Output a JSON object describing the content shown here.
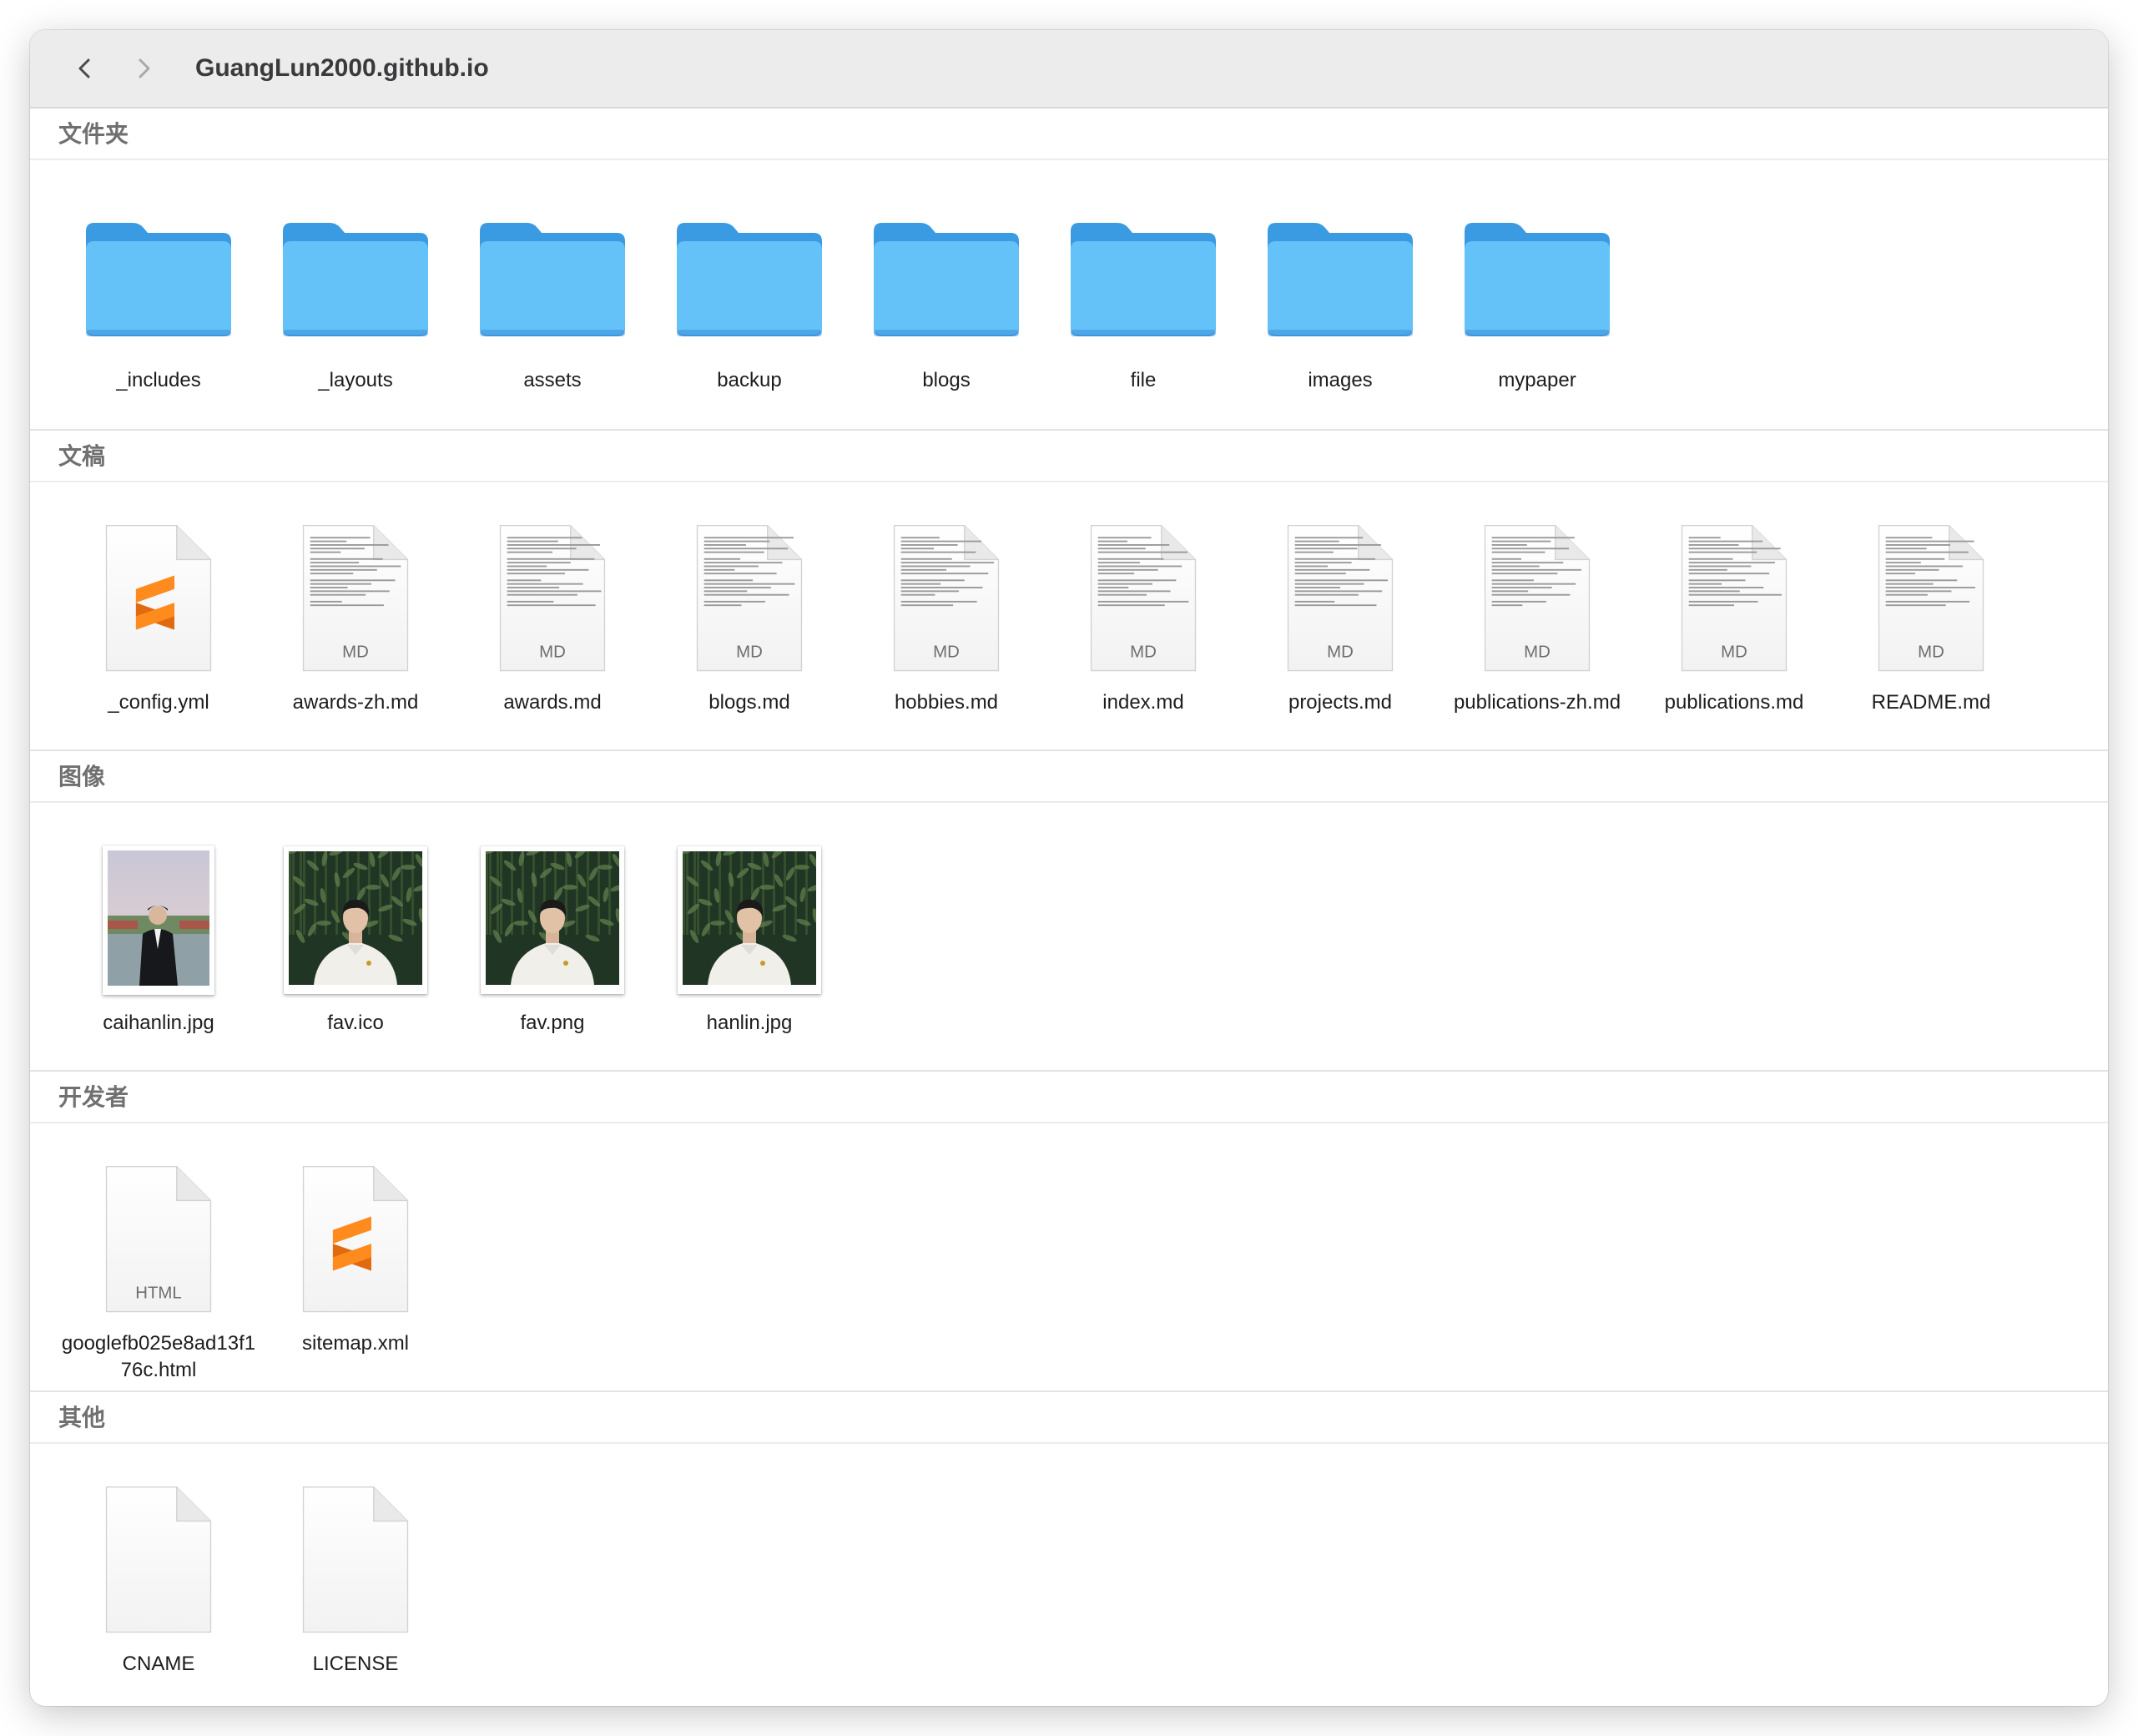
{
  "toolbar": {
    "title": "GuangLun2000.github.io"
  },
  "colors": {
    "folder_back": "#3a9be3",
    "folder_front": "#65c2f8",
    "sublime_orange": "#ff8a1e",
    "page_label": "#6e6e6e"
  },
  "sections": [
    {
      "title": "文件夹",
      "items": [
        {
          "name": "_includes",
          "icon": "folder-icon"
        },
        {
          "name": "_layouts",
          "icon": "folder-icon"
        },
        {
          "name": "assets",
          "icon": "folder-icon"
        },
        {
          "name": "backup",
          "icon": "folder-icon"
        },
        {
          "name": "blogs",
          "icon": "folder-icon"
        },
        {
          "name": "file",
          "icon": "folder-icon"
        },
        {
          "name": "images",
          "icon": "folder-icon"
        },
        {
          "name": "mypaper",
          "icon": "folder-icon"
        }
      ]
    },
    {
      "title": "文稿",
      "items": [
        {
          "name": "_config.yml",
          "icon": "sublime-file-icon"
        },
        {
          "name": "awards-zh.md",
          "icon": "markdown-file-icon",
          "tag": "MD"
        },
        {
          "name": "awards.md",
          "icon": "markdown-file-icon",
          "tag": "MD"
        },
        {
          "name": "blogs.md",
          "icon": "markdown-file-icon",
          "tag": "MD"
        },
        {
          "name": "hobbies.md",
          "icon": "markdown-file-icon",
          "tag": "MD"
        },
        {
          "name": "index.md",
          "icon": "markdown-file-icon",
          "tag": "MD"
        },
        {
          "name": "projects.md",
          "icon": "markdown-file-icon",
          "tag": "MD"
        },
        {
          "name": "publications-zh.md",
          "icon": "markdown-file-icon",
          "tag": "MD"
        },
        {
          "name": "publications.md",
          "icon": "markdown-file-icon",
          "tag": "MD"
        },
        {
          "name": "README.md",
          "icon": "markdown-file-icon",
          "tag": "MD"
        }
      ]
    },
    {
      "title": "图像",
      "items": [
        {
          "name": "caihanlin.jpg",
          "icon": "portrait-photo-thumbnail-icon"
        },
        {
          "name": "fav.ico",
          "icon": "bamboo-photo-thumbnail-icon"
        },
        {
          "name": "fav.png",
          "icon": "bamboo-photo-thumbnail-icon"
        },
        {
          "name": "hanlin.jpg",
          "icon": "bamboo-photo-thumbnail-icon"
        }
      ]
    },
    {
      "title": "开发者",
      "items": [
        {
          "name": "googlefb025e8ad13f176c.html",
          "icon": "html-file-icon",
          "tag": "HTML"
        },
        {
          "name": "sitemap.xml",
          "icon": "sublime-file-icon"
        }
      ]
    },
    {
      "title": "其他",
      "items": [
        {
          "name": "CNAME",
          "icon": "blank-file-icon"
        },
        {
          "name": "LICENSE",
          "icon": "blank-file-icon"
        }
      ]
    }
  ]
}
